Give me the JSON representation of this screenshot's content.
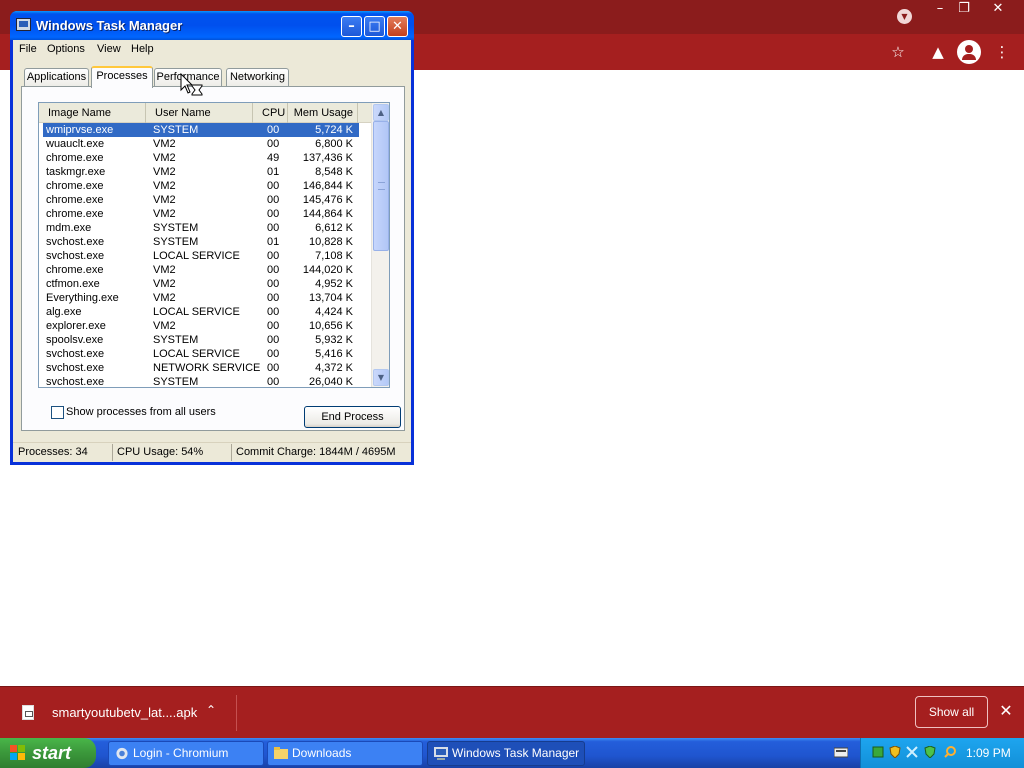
{
  "chromium": {
    "download": {
      "filename": "smartyoutubetv_lat....apk",
      "show_all_label": "Show all"
    }
  },
  "taskbar": {
    "start_label": "start",
    "buttons": [
      {
        "label": "Login - Chromium",
        "icon": "chromium-icon"
      },
      {
        "label": "Downloads",
        "icon": "folder-icon"
      },
      {
        "label": "Windows Task Manager",
        "icon": "task-manager-icon"
      }
    ],
    "clock": "1:09 PM"
  },
  "task_manager": {
    "title": "Windows Task Manager",
    "menu": [
      "File",
      "Options",
      "View",
      "Help"
    ],
    "tabs": [
      "Applications",
      "Processes",
      "Performance",
      "Networking"
    ],
    "active_tab": "Processes",
    "columns": [
      "Image Name",
      "User Name",
      "CPU",
      "Mem Usage"
    ],
    "processes": [
      {
        "name": "wmiprvse.exe",
        "user": "SYSTEM",
        "cpu": "00",
        "mem": "5,724 K"
      },
      {
        "name": "wuauclt.exe",
        "user": "VM2",
        "cpu": "00",
        "mem": "6,800 K"
      },
      {
        "name": "chrome.exe",
        "user": "VM2",
        "cpu": "49",
        "mem": "137,436 K"
      },
      {
        "name": "taskmgr.exe",
        "user": "VM2",
        "cpu": "01",
        "mem": "8,548 K"
      },
      {
        "name": "chrome.exe",
        "user": "VM2",
        "cpu": "00",
        "mem": "146,844 K"
      },
      {
        "name": "chrome.exe",
        "user": "VM2",
        "cpu": "00",
        "mem": "145,476 K"
      },
      {
        "name": "chrome.exe",
        "user": "VM2",
        "cpu": "00",
        "mem": "144,864 K"
      },
      {
        "name": "mdm.exe",
        "user": "SYSTEM",
        "cpu": "00",
        "mem": "6,612 K"
      },
      {
        "name": "svchost.exe",
        "user": "SYSTEM",
        "cpu": "01",
        "mem": "10,828 K"
      },
      {
        "name": "svchost.exe",
        "user": "LOCAL SERVICE",
        "cpu": "00",
        "mem": "7,108 K"
      },
      {
        "name": "chrome.exe",
        "user": "VM2",
        "cpu": "00",
        "mem": "144,020 K"
      },
      {
        "name": "ctfmon.exe",
        "user": "VM2",
        "cpu": "00",
        "mem": "4,952 K"
      },
      {
        "name": "Everything.exe",
        "user": "VM2",
        "cpu": "00",
        "mem": "13,704 K"
      },
      {
        "name": "alg.exe",
        "user": "LOCAL SERVICE",
        "cpu": "00",
        "mem": "4,424 K"
      },
      {
        "name": "explorer.exe",
        "user": "VM2",
        "cpu": "00",
        "mem": "10,656 K"
      },
      {
        "name": "spoolsv.exe",
        "user": "SYSTEM",
        "cpu": "00",
        "mem": "5,932 K"
      },
      {
        "name": "svchost.exe",
        "user": "LOCAL SERVICE",
        "cpu": "00",
        "mem": "5,416 K"
      },
      {
        "name": "svchost.exe",
        "user": "NETWORK SERVICE",
        "cpu": "00",
        "mem": "4,372 K"
      },
      {
        "name": "svchost.exe",
        "user": "SYSTEM",
        "cpu": "00",
        "mem": "26,040 K"
      }
    ],
    "selected_index": 0,
    "show_all_users_label": "Show processes from all users",
    "end_process_label": "End Process",
    "status": {
      "processes": "Processes: 34",
      "cpu": "CPU Usage: 54%",
      "commit": "Commit Charge: 1844M / 4695M"
    }
  }
}
